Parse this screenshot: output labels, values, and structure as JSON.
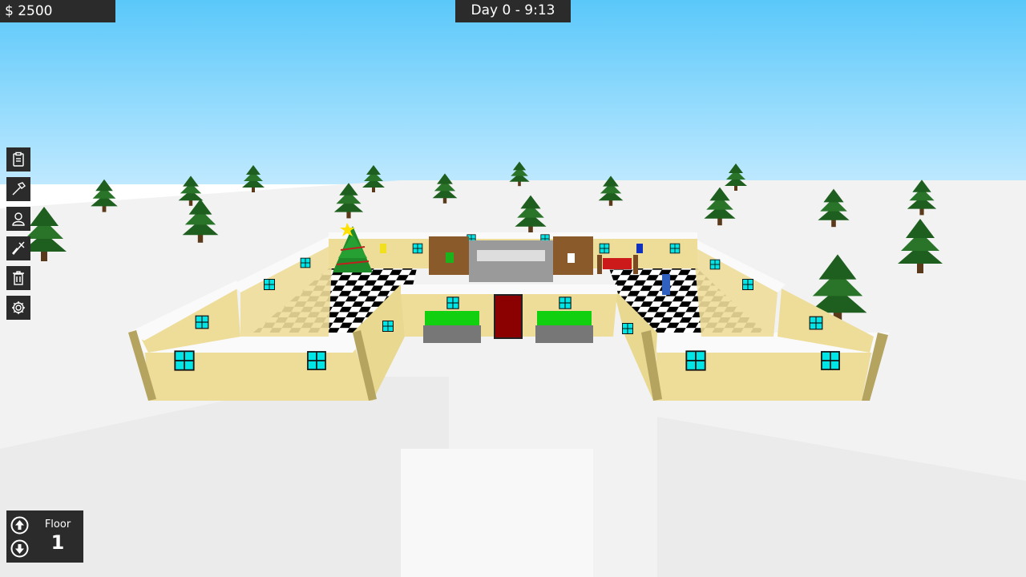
{
  "hud": {
    "money": "$ 2500",
    "day_time": "Day 0 - 9:13"
  },
  "toolbar": {
    "tools": [
      {
        "name": "clipboard-icon"
      },
      {
        "name": "hammer-icon"
      },
      {
        "name": "person-icon"
      },
      {
        "name": "paint-brush-icon"
      },
      {
        "name": "trash-icon"
      },
      {
        "name": "gear-icon"
      }
    ]
  },
  "floor": {
    "label": "Floor",
    "number": "1",
    "up_icon": "arrow-up-circle-icon",
    "down_icon": "arrow-down-circle-icon"
  },
  "colors": {
    "sky_top": "#5ac8fa",
    "snow": "#f2f2f2",
    "wall": "#eedd99",
    "window": "#00e5e5",
    "tree": "#1e5e1e",
    "hud": "#2b2b2b"
  }
}
